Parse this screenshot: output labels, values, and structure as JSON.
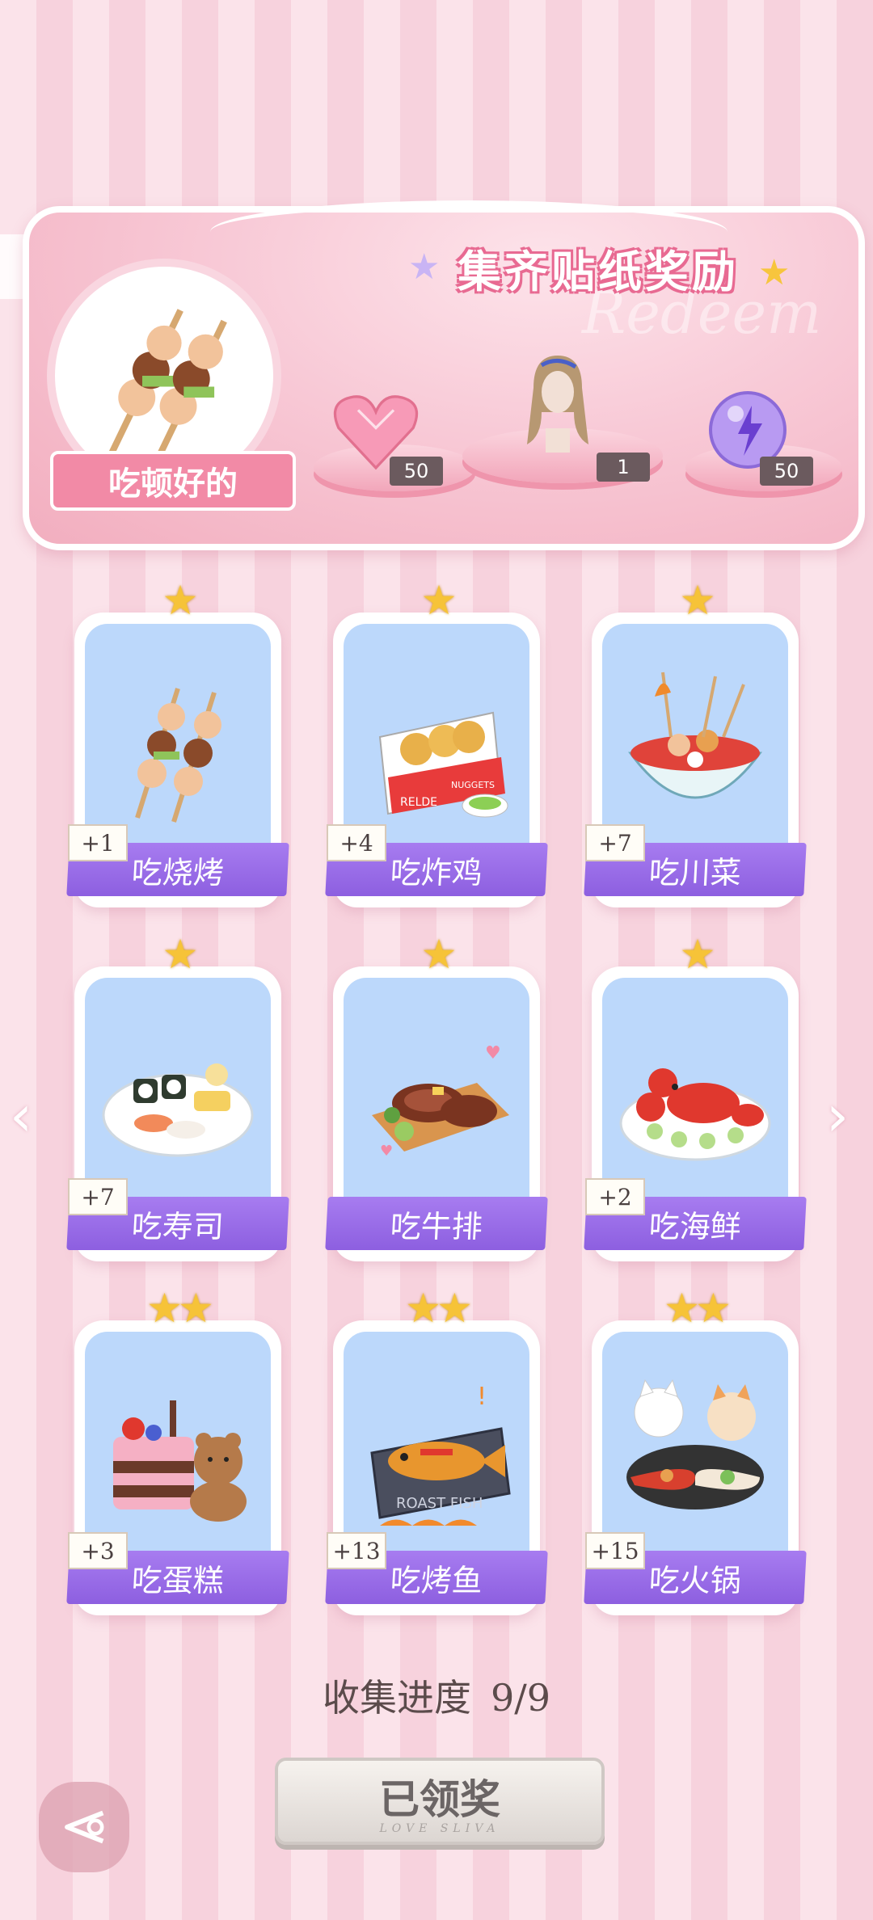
{
  "banner": {
    "title": "集齐贴纸奖励",
    "watermark": "Redeem",
    "main_item_label": "吃顿好的",
    "rewards": [
      {
        "icon": "pink-heart-gem-icon",
        "count": "50"
      },
      {
        "icon": "hairstyle-bust-icon",
        "count": "1"
      },
      {
        "icon": "purple-energy-orb-icon",
        "count": "50"
      }
    ]
  },
  "cards": [
    {
      "label": "吃烧烤",
      "count": "+1",
      "stars": "★",
      "icon": "bbq-skewers-icon"
    },
    {
      "label": "吃炸鸡",
      "count": "+4",
      "stars": "★",
      "icon": "chicken-nuggets-icon"
    },
    {
      "label": "吃川菜",
      "count": "+7",
      "stars": "★",
      "icon": "sichuan-bowl-icon"
    },
    {
      "label": "吃寿司",
      "count": "+7",
      "stars": "★",
      "icon": "sushi-plate-icon"
    },
    {
      "label": "吃牛排",
      "count": "",
      "stars": "★",
      "icon": "steak-board-icon"
    },
    {
      "label": "吃海鲜",
      "count": "+2",
      "stars": "★",
      "icon": "lobster-plate-icon"
    },
    {
      "label": "吃蛋糕",
      "count": "+3",
      "stars": "★★",
      "icon": "cake-bear-icon"
    },
    {
      "label": "吃烤鱼",
      "count": "+13",
      "stars": "★★",
      "icon": "roast-fish-icon"
    },
    {
      "label": "吃火锅",
      "count": "+15",
      "stars": "★★",
      "icon": "hotpot-cats-icon"
    }
  ],
  "card_art_text": {
    "nuggets_box": "RELDE",
    "nuggets_label": "NUGGETS",
    "roast_fish": "ROAST FISH"
  },
  "progress": {
    "label": "收集进度",
    "value": "9/9"
  },
  "claim_button": {
    "label": "已领奖",
    "sub": "LOVE SLIVA"
  },
  "colors": {
    "card_label": "#9a6ae8",
    "card_inner": "#bcd8fb",
    "star": "#f6c338",
    "banner_pink": "#f2aebf"
  }
}
